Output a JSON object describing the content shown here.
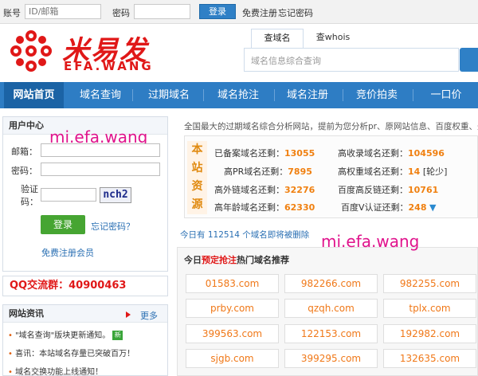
{
  "topbar": {
    "account_label": "账号",
    "account_placeholder": "ID/邮箱",
    "password_label": "密码",
    "login_button": "登录",
    "register_link": "免费注册",
    "forgot_link": "忘记密码"
  },
  "logo": {
    "cn": "米易发",
    "en": "EFA.WANG"
  },
  "search": {
    "tabs": [
      "查域名",
      "查whois"
    ],
    "placeholder": "域名信息综合查询"
  },
  "nav": {
    "items": [
      "网站首页",
      "域名查询",
      "过期域名",
      "域名抢注",
      "域名注册",
      "竞价拍卖",
      "一口价"
    ]
  },
  "user_center": {
    "title": "用户中心",
    "email_label": "邮箱：",
    "password_label": "密码：",
    "captcha_label_1": "验证",
    "captcha_label_2": "码：",
    "captcha_code": "nch2",
    "login_button": "登录",
    "forgot_link": "忘记密码？",
    "register_link": "免费注册会员",
    "watermark": "mi.efa.wang"
  },
  "qq_group": "QQ交流群：40900463",
  "news": {
    "title": "网站资讯",
    "more": "更多",
    "items": [
      {
        "text": "\"域名查询\"版块更新通知。",
        "new": "新"
      },
      {
        "text": "喜讯：本站域名存量已突破百万！"
      },
      {
        "text": "域名交换功能上线通知！"
      }
    ]
  },
  "intro": "全国最大的过期域名综合分析网站，提前为您分析pr、原网站信息、百度权重、外",
  "stats": {
    "vertical_title": [
      "本",
      "站",
      "资",
      "源"
    ],
    "rows": [
      {
        "label": "已备案域名还剩：",
        "value": "13055"
      },
      {
        "label": "高收录域名还剩：",
        "value": "104596"
      },
      {
        "label": "高PR域名还剩：",
        "value": "7895"
      },
      {
        "label": "高权重域名还剩：",
        "value": "14",
        "tag": "[轮少]"
      },
      {
        "label": "高外链域名还剩：",
        "value": "32276"
      },
      {
        "label": "百度高反链还剩：",
        "value": "10761"
      },
      {
        "label": "高年龄域名还剩：",
        "value": "62330"
      },
      {
        "label": "百度V认证还剩：",
        "value": "248"
      }
    ]
  },
  "today": "今日有 112514 个域名即将被删除",
  "recommend": {
    "head_prefix": "今日",
    "head_red": "预定抢注",
    "head_suffix": "热门域名推荐",
    "watermark": "mi.efa.wang",
    "domains": [
      "01583.com",
      "982266.com",
      "982255.com",
      "prby.com",
      "qzqh.com",
      "tplx.com",
      "399563.com",
      "122153.com",
      "192982.com",
      "sjgb.com",
      "399295.com",
      "132635.com"
    ]
  },
  "colors": {
    "brand_red": "#e01818",
    "nav_blue": "#2e7dc4",
    "value_orange": "#f08010",
    "watermark_pink": "#e0138c"
  }
}
